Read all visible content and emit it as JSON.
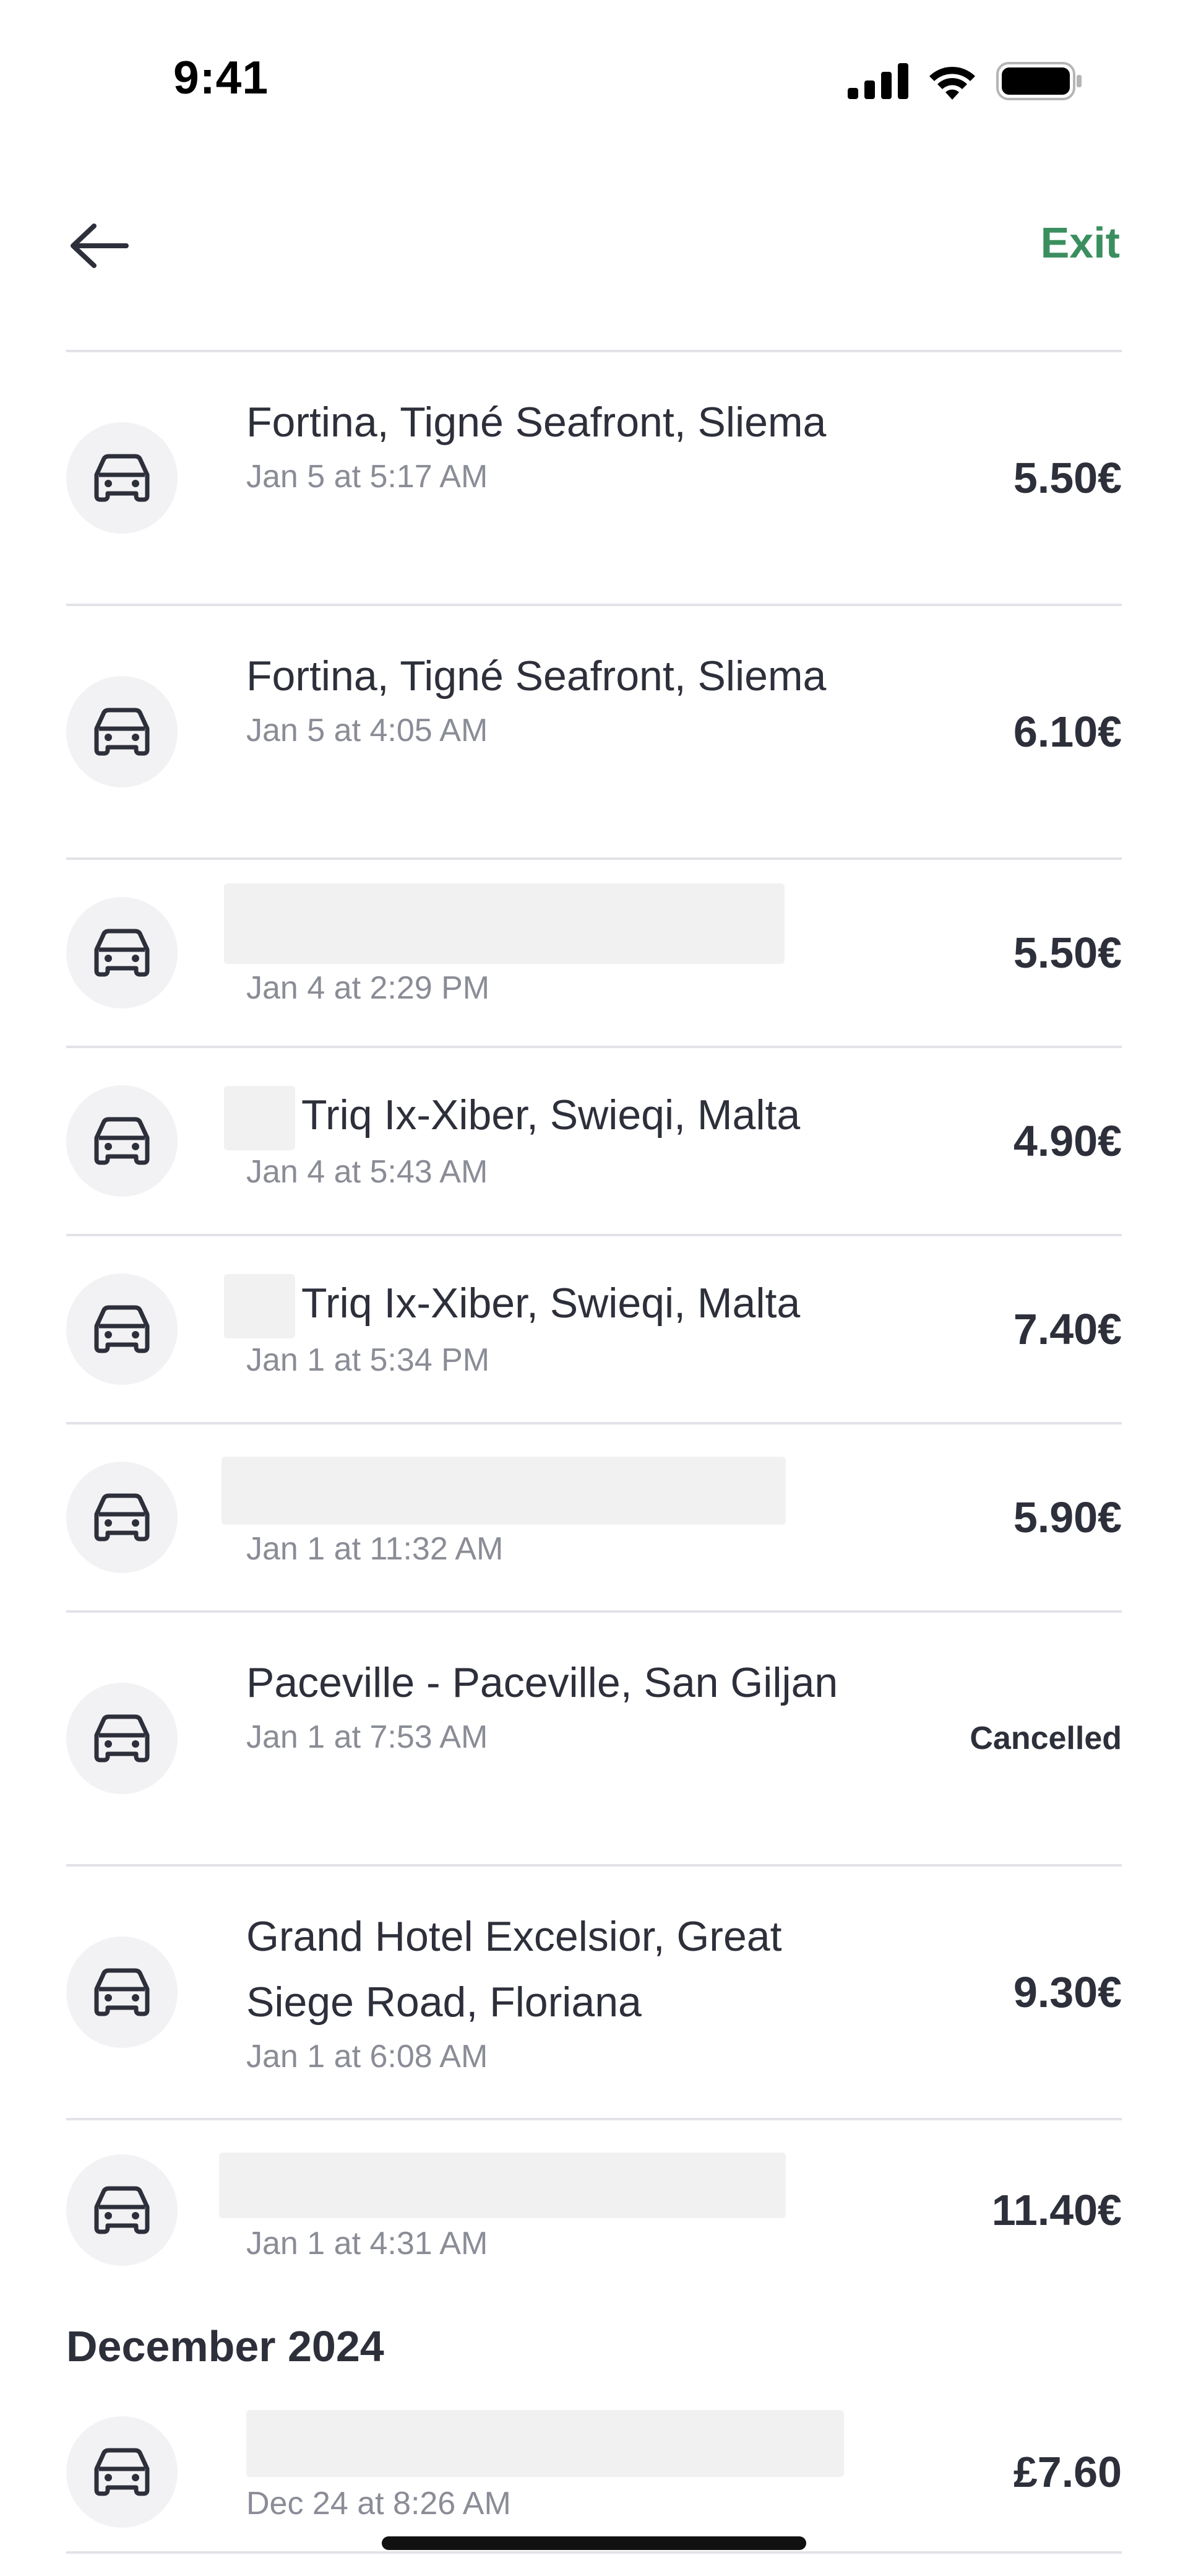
{
  "status_bar": {
    "time": "9:41"
  },
  "nav": {
    "exit_label": "Exit"
  },
  "rides": [
    {
      "title": "Fortina, Tigné Seafront, Sliema",
      "time": "Jan 5 at 5:17 AM",
      "price": "5.50€"
    },
    {
      "title": "Fortina, Tigné Seafront, Sliema",
      "time": "Jan 5 at 4:05 AM",
      "price": "6.10€"
    },
    {
      "title": "",
      "time": "Jan 4 at 2:29 PM",
      "price": "5.50€"
    },
    {
      "title": "Triq Ix-Xiber, Swieqi, Malta",
      "time": "Jan 4 at 5:43 AM",
      "price": "4.90€"
    },
    {
      "title": "Triq Ix-Xiber, Swieqi, Malta",
      "time": "Jan 1 at 5:34 PM",
      "price": "7.40€"
    },
    {
      "title": "",
      "time": "Jan 1 at 11:32 AM",
      "price": "5.90€"
    },
    {
      "title": "Paceville - Paceville, San Giljan",
      "time": "Jan 1 at 7:53 AM",
      "price": "Cancelled"
    },
    {
      "title": "Grand Hotel Excelsior, Great Siege Road, Floriana",
      "time": "Jan 1 at 6:08 AM",
      "price": "9.30€"
    },
    {
      "title": "",
      "time": "Jan 1 at 4:31 AM",
      "price": "11.40€"
    }
  ],
  "sections": [
    {
      "header": "December 2024",
      "rides": [
        {
          "title": "",
          "time": "Dec 24 at 8:26 AM",
          "price": "£7.60"
        }
      ]
    }
  ],
  "colors": {
    "accent": "#3b8f5f",
    "text": "#2d2f3a",
    "muted": "#8a8c96",
    "divider": "#e2e3e7",
    "icon_bg": "#f2f2f4"
  },
  "icons": {
    "back": "arrow-left-icon",
    "ride": "car-icon",
    "signal": "cellular-signal-icon",
    "wifi": "wifi-icon",
    "battery": "battery-icon"
  }
}
